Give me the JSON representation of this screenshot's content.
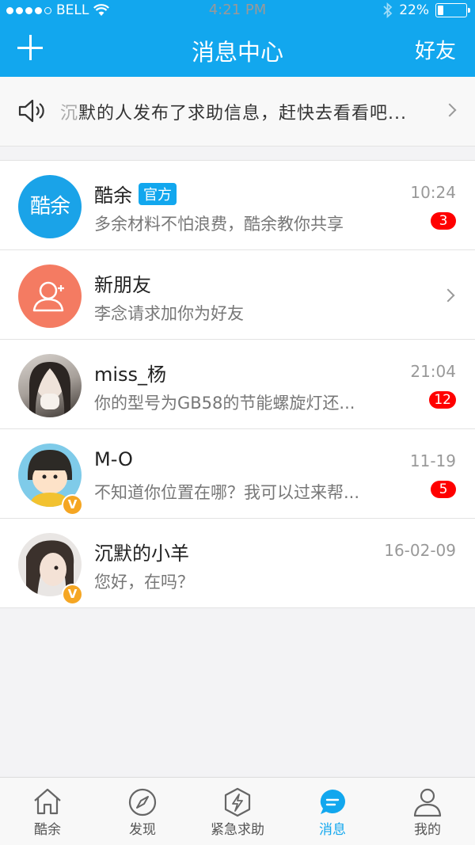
{
  "status_bar": {
    "carrier": "BELL",
    "time": "4:21 PM",
    "battery": "22%",
    "battery_level": 0.22
  },
  "nav": {
    "title": "消息中心",
    "right_label": "好友"
  },
  "notice": {
    "prefix": "沉",
    "text": "默的人发布了求助信息，赶快去看看吧..."
  },
  "messages": [
    {
      "name": "酷余",
      "tag": "官方",
      "preview": "多余材料不怕浪费，酷余教你共享",
      "time": "10:24",
      "unread": "3",
      "logo_text": "酷余"
    },
    {
      "name": "新朋友",
      "preview": "李念请求加你为好友"
    },
    {
      "name": "miss_杨",
      "preview": "你的型号为GB58的节能螺旋灯还...",
      "time": "21:04",
      "unread": "12"
    },
    {
      "name": "M-O",
      "preview": "不知道你位置在哪？我可以过来帮...",
      "time": "11-19",
      "unread": "5",
      "badge": "V"
    },
    {
      "name": "沉默的小羊",
      "preview": "您好，在吗？",
      "time": "16-02-09",
      "badge": "V"
    }
  ],
  "tabs": [
    {
      "label": "酷余",
      "icon": "home-icon"
    },
    {
      "label": "发现",
      "icon": "compass-icon"
    },
    {
      "label": "紧急求助",
      "icon": "lightning-icon"
    },
    {
      "label": "消息",
      "icon": "message-icon",
      "active": true
    },
    {
      "label": "我的",
      "icon": "person-icon"
    }
  ],
  "colors": {
    "brand": "#12a7ee",
    "unread": "#ff0000",
    "badge": "#f5a623"
  }
}
